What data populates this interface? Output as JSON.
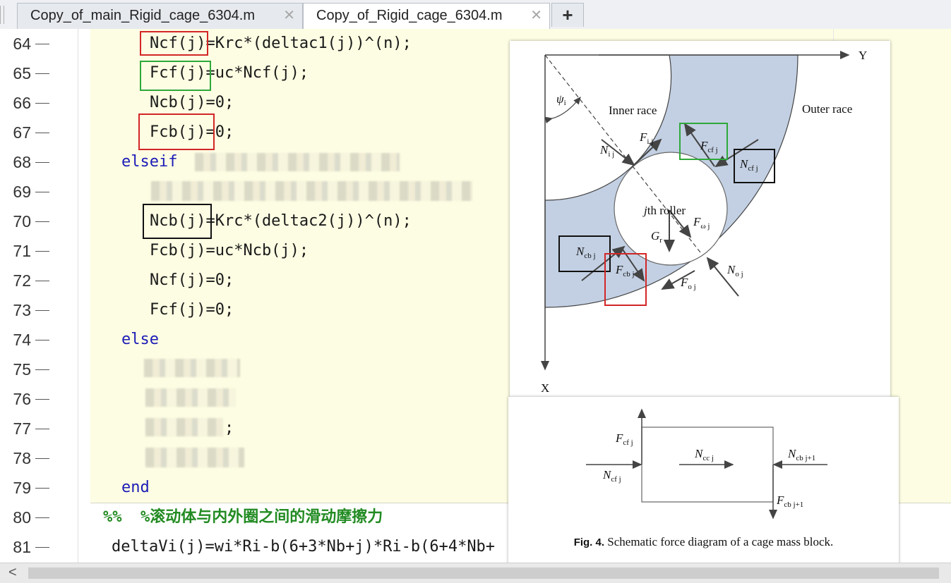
{
  "tabs": [
    {
      "label": "Copy_of_main_Rigid_cage_6304.m",
      "active": false
    },
    {
      "label": "Copy_of_Rigid_cage_6304.m",
      "active": true
    }
  ],
  "tab_close": "✕",
  "tab_add": "+",
  "lines": [
    {
      "n": "64",
      "code": "Ncf(j)=Krc*(deltac1(j))^(n);"
    },
    {
      "n": "65",
      "code": "Fcf(j)=uc*Ncf(j);"
    },
    {
      "n": "66",
      "code": "Ncb(j)=0;"
    },
    {
      "n": "67",
      "code": "Fcb(j)=0;"
    },
    {
      "n": "68",
      "code": "elseif"
    },
    {
      "n": "69",
      "code": ""
    },
    {
      "n": "70",
      "code": "Ncb(j)=Krc*(deltac2(j))^(n);"
    },
    {
      "n": "71",
      "code": "Fcb(j)=uc*Ncb(j);"
    },
    {
      "n": "72",
      "code": "Ncf(j)=0;"
    },
    {
      "n": "73",
      "code": "Fcf(j)=0;"
    },
    {
      "n": "74",
      "code": "else"
    },
    {
      "n": "75",
      "code": ""
    },
    {
      "n": "76",
      "code": ""
    },
    {
      "n": "77",
      "code": ";"
    },
    {
      "n": "78",
      "code": ""
    },
    {
      "n": "79",
      "code": "end"
    },
    {
      "n": "80",
      "code": "%%  %滚动体与内外圈之间的滑动摩擦力"
    },
    {
      "n": "81",
      "code": "deltaVi(j)=wi*Ri-b(6+3*Nb+j)*Ri-b(6+4*Nb+"
    }
  ],
  "figure1": {
    "axis_y": "Y",
    "axis_x": "X",
    "psi": "ψ",
    "psi_sub": "i",
    "inner_race": "Inner race",
    "outer_race": "Outer race",
    "roller_italic": "j",
    "roller_rest": "th roller",
    "labels": {
      "Nij": "N",
      "Nij_sub": "i j",
      "Fij": "F",
      "Fij_sub": "i j",
      "Fcfj": "F",
      "Fcfj_sub": "cf j",
      "Ncfj": "N",
      "Ncfj_sub": "cf j",
      "Fwj": "F",
      "Fwj_sub": "ω j",
      "Gr": "G",
      "Gr_sub": "r",
      "Ncbj": "N",
      "Ncbj_sub": "cb j",
      "Fcbj": "F",
      "Fcbj_sub": "cb j",
      "Noj": "N",
      "Noj_sub": "o j",
      "Foj": "F",
      "Foj_sub": "o j"
    }
  },
  "figure2": {
    "Fcfj": "F",
    "Fcfj_sub": "cf j",
    "Ncfj": "N",
    "Ncfj_sub": "cf j",
    "Nccj": "N",
    "Nccj_sub": "cc j",
    "Ncbj1": "N",
    "Ncbj1_sub": "cb j+1",
    "Fcbj1": "F",
    "Fcbj1_sub": "cb j+1",
    "caption_bold": "Fig. 4.",
    "caption_text": " Schematic force diagram of a cage mass block."
  },
  "scroll_left": "<",
  "colors": {
    "editor_highlight": "#fdfde3",
    "keyword": "#1c1cb8",
    "comment": "#228b22",
    "box_red": "#d32626",
    "box_green": "#2ea83a",
    "race_fill": "#c3d0e3"
  }
}
